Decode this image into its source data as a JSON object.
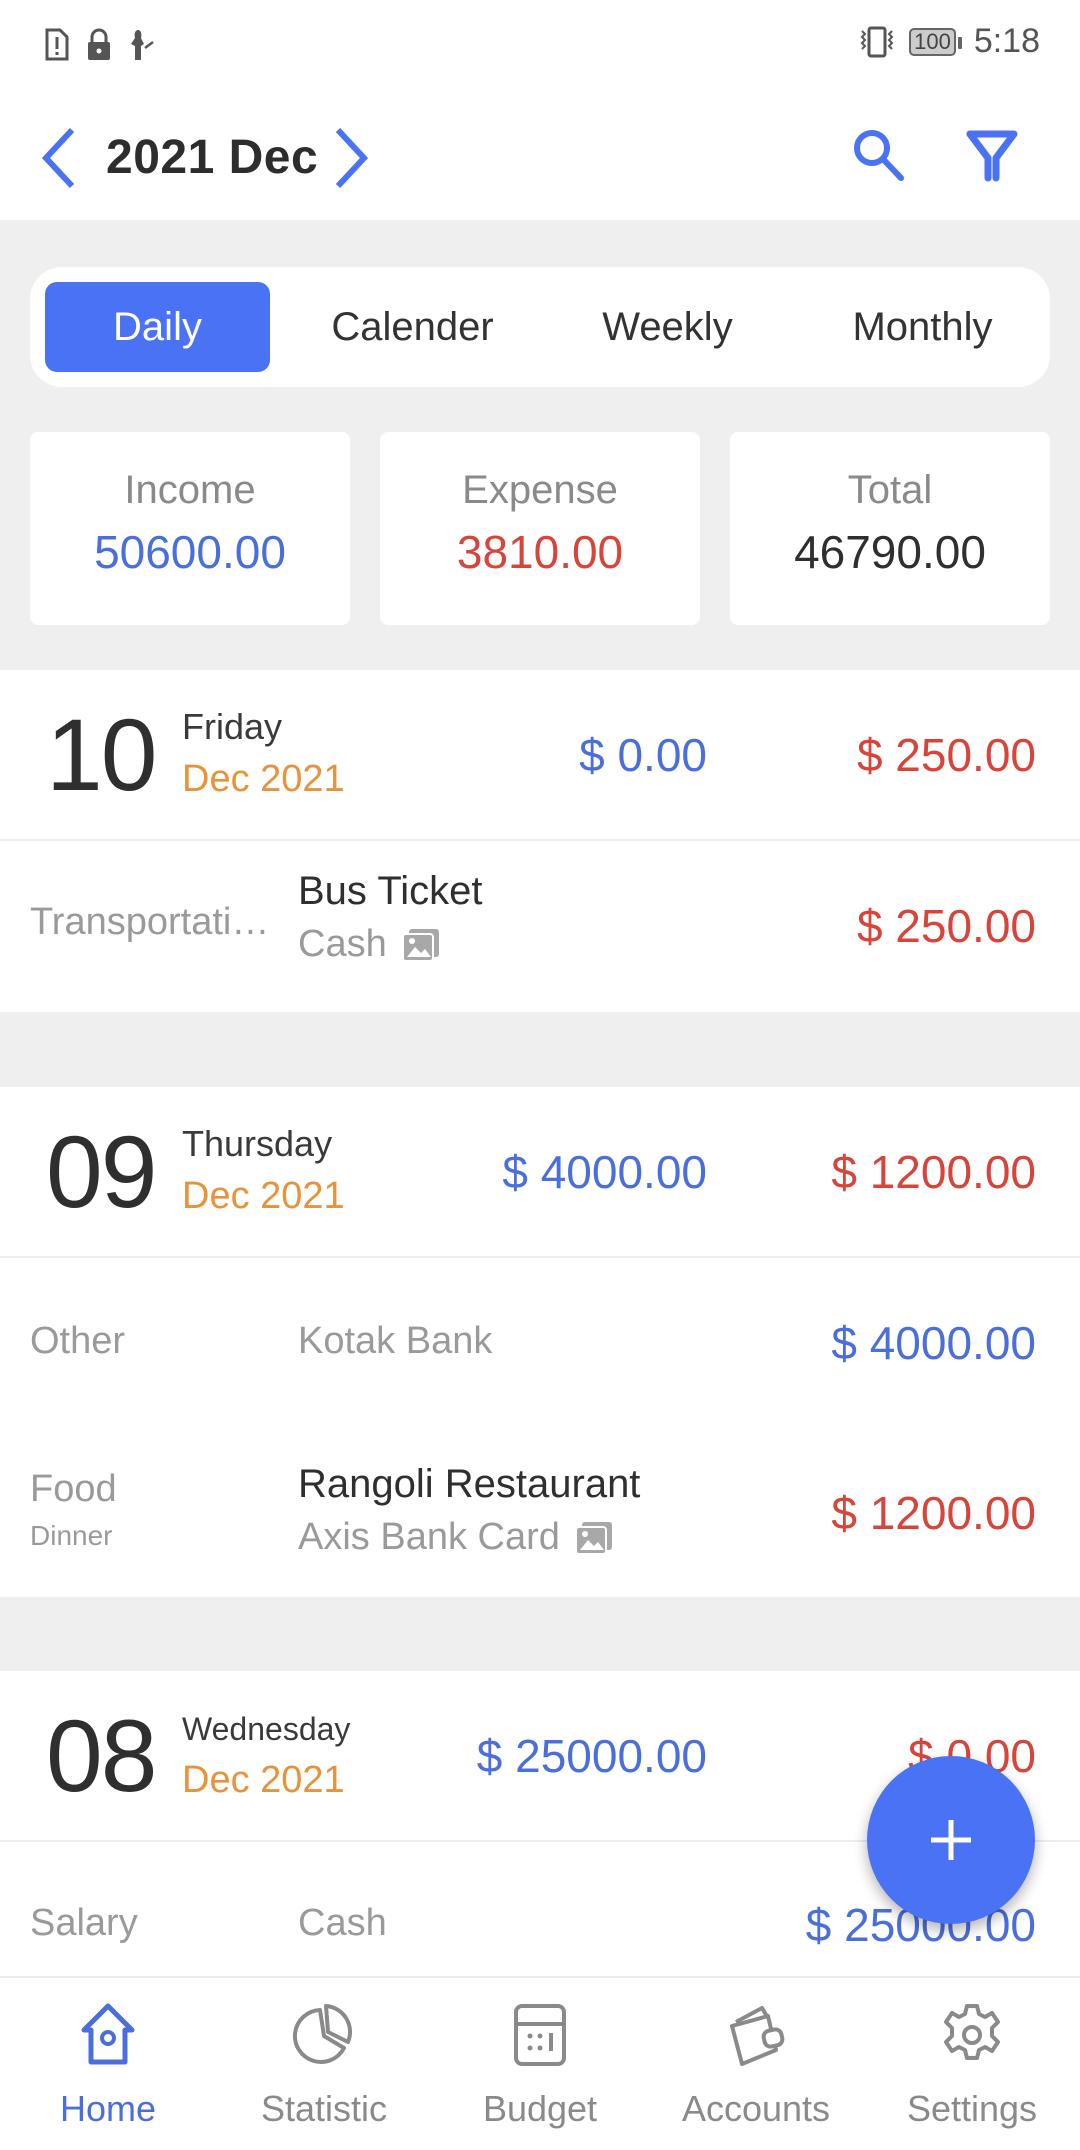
{
  "status_bar": {
    "left_icons": [
      "sim-alert-icon",
      "lock-icon",
      "notification-icon"
    ],
    "right_icons": [
      "vibrate-icon",
      "battery-icon"
    ],
    "battery": "100",
    "time": "5:18"
  },
  "header": {
    "title": "2021 Dec",
    "prev_icon": "chevron-left-icon",
    "next_icon": "chevron-right-icon",
    "search_icon": "search-icon",
    "filter_icon": "filter-icon",
    "accent_color": "#4a72f5"
  },
  "tabs": [
    {
      "label": "Daily",
      "active": true
    },
    {
      "label": "Calender",
      "active": false
    },
    {
      "label": "Weekly",
      "active": false
    },
    {
      "label": "Monthly",
      "active": false
    }
  ],
  "summary": {
    "income": {
      "label": "Income",
      "value": "50600.00",
      "color": "#4a6fdc"
    },
    "expense": {
      "label": "Expense",
      "value": "3810.00",
      "color": "#d9443a"
    },
    "total": {
      "label": "Total",
      "value": "46790.00",
      "color": "#2f2f2f"
    }
  },
  "days": [
    {
      "day": "10",
      "weekday": "Friday",
      "month": "Dec 2021",
      "income": "$ 0.00",
      "expense": "$ 250.00",
      "transactions": [
        {
          "category": "Transportation",
          "subcategory": "",
          "title": "Bus Ticket",
          "account": "Cash",
          "has_image": true,
          "amount": "$ 250.00",
          "type": "expense"
        }
      ]
    },
    {
      "day": "09",
      "weekday": "Thursday",
      "month": "Dec 2021",
      "income": "$ 4000.00",
      "expense": "$ 1200.00",
      "transactions": [
        {
          "category": "Other",
          "subcategory": "",
          "title": "",
          "account": "Kotak Bank",
          "has_image": false,
          "amount": "$ 4000.00",
          "type": "income"
        },
        {
          "category": "Food",
          "subcategory": "Dinner",
          "title": "Rangoli Restaurant",
          "account": "Axis Bank Card",
          "has_image": true,
          "amount": "$ 1200.00",
          "type": "expense"
        }
      ]
    },
    {
      "day": "08",
      "weekday": "Wednesday",
      "month": "Dec 2021",
      "income": "$ 25000.00",
      "expense": "$ 0.00",
      "transactions": [
        {
          "category": "Salary",
          "subcategory": "",
          "title": "",
          "account": "Cash",
          "has_image": false,
          "amount": "$ 25000.00",
          "type": "income"
        }
      ]
    }
  ],
  "fab": {
    "icon": "plus-icon"
  },
  "bottom_nav": [
    {
      "label": "Home",
      "icon": "home-icon",
      "active": true
    },
    {
      "label": "Statistic",
      "icon": "pie-chart-icon",
      "active": false
    },
    {
      "label": "Budget",
      "icon": "calculator-icon",
      "active": false
    },
    {
      "label": "Accounts",
      "icon": "wallet-icon",
      "active": false
    },
    {
      "label": "Settings",
      "icon": "gear-icon",
      "active": false
    }
  ]
}
